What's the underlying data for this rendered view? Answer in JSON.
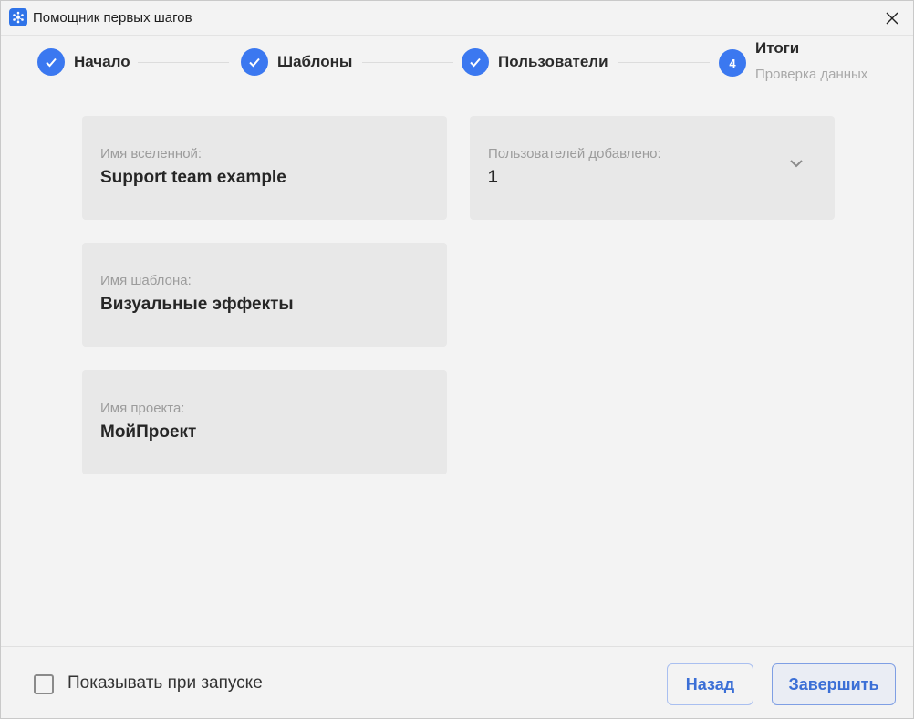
{
  "window": {
    "title": "Помощник первых шагов"
  },
  "stepper": {
    "steps": [
      {
        "label": "Начало",
        "status": "done"
      },
      {
        "label": "Шаблоны",
        "status": "done"
      },
      {
        "label": "Пользователи",
        "status": "done"
      },
      {
        "number": "4",
        "label": "Итоги",
        "sublabel": "Проверка данных",
        "status": "current"
      }
    ]
  },
  "summary": {
    "universe": {
      "label": "Имя вселенной:",
      "value": "Support team example"
    },
    "users": {
      "label": "Пользователей добавлено:",
      "value": "1"
    },
    "template": {
      "label": "Имя шаблона:",
      "value": "Визуальные эффекты"
    },
    "project": {
      "label": "Имя проекта:",
      "value": "МойПроект"
    }
  },
  "footer": {
    "show_on_startup_label": "Показывать при запуске",
    "show_on_startup_checked": false,
    "back_label": "Назад",
    "finish_label": "Завершить"
  },
  "colors": {
    "accent": "#3b78f0",
    "card_bg": "#e8e8e8",
    "window_bg": "#f3f3f3",
    "button_text": "#3b6fd6"
  },
  "icons": {
    "app": "app-logo-icon",
    "close": "close-icon",
    "step_done": "checkmark-icon",
    "expand": "chevron-down-icon"
  }
}
